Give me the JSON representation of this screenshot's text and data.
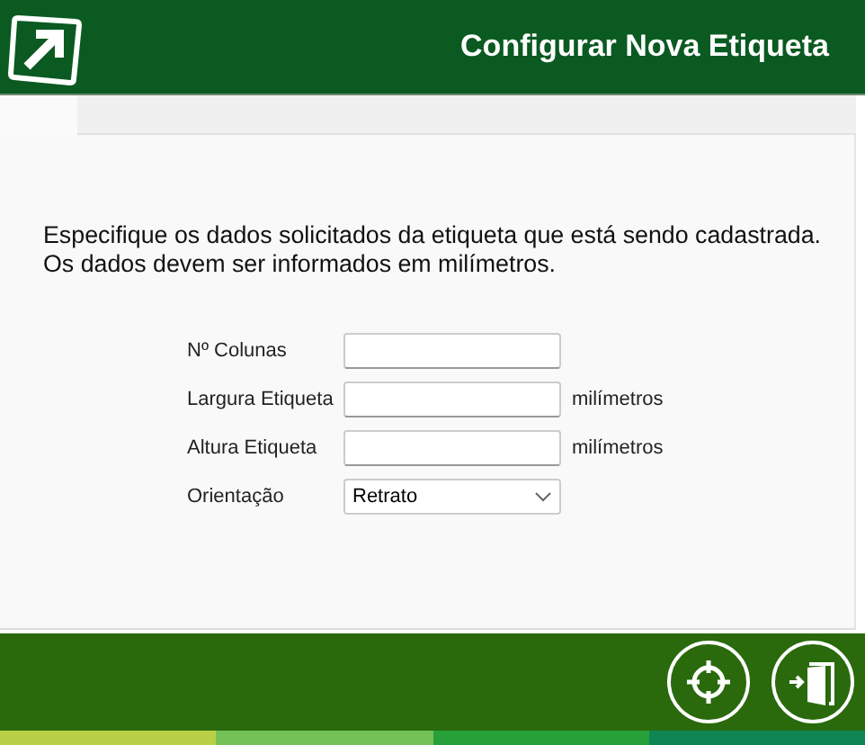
{
  "header": {
    "title": "Configurar Nova Etiqueta"
  },
  "description": [
    "Especifique os dados solicitados da etiqueta que está sendo cadastrada.",
    "Os dados devem ser informados em milímetros."
  ],
  "fields": [
    {
      "kind": "text",
      "label": "Nº Colunas"
    },
    {
      "kind": "text",
      "label": "Largura Etiqueta",
      "unit": "milímetros"
    },
    {
      "kind": "text",
      "label": "Altura Etiqueta",
      "unit": "milímetros"
    },
    {
      "kind": "select",
      "label": "Orientação",
      "value": "Retrato"
    }
  ]
}
